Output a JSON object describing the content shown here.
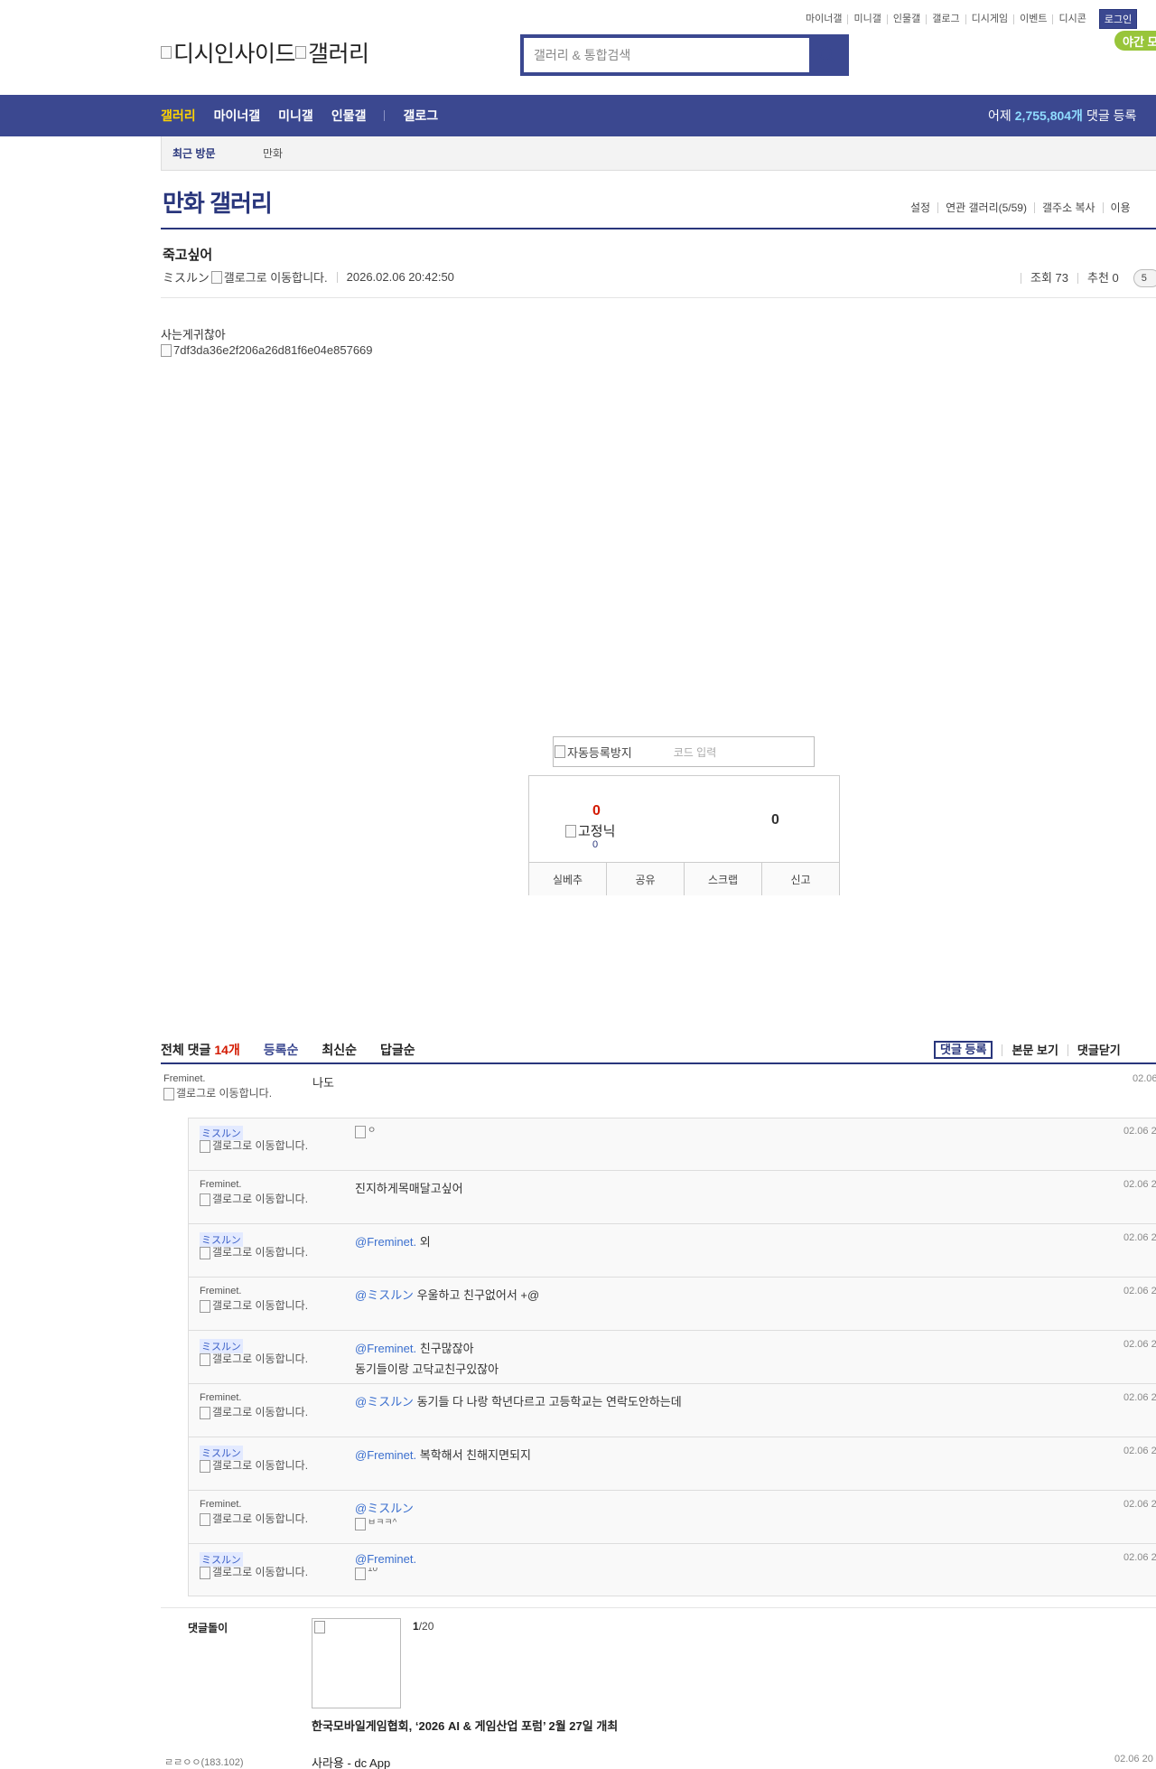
{
  "util_nav": [
    "마이너갤",
    "미니갤",
    "인물갤",
    "갤로그",
    "디시게임",
    "이벤트",
    "디시콘"
  ],
  "login": "로그인",
  "logo": {
    "site": "디시인사이드",
    "section": "갤러리"
  },
  "search": {
    "placeholder": "갤러리 & 통합검색"
  },
  "night_mode": "야간 모",
  "main_nav": {
    "items": [
      "갤러리",
      "마이너갤",
      "미니갤",
      "인물갤"
    ],
    "extra": "갤로그"
  },
  "stats": {
    "prefix": "어제",
    "count": "2,755,804개",
    "suffix": "댓글 등록"
  },
  "recent": {
    "label": "최근 방문",
    "gallery": "만화"
  },
  "gallery": {
    "title": "만화 갤러리",
    "tools": [
      "설정",
      "연관 갤러리(5/59)",
      "갤주소 복사",
      "이용"
    ]
  },
  "post": {
    "title": "죽고싶어",
    "author": "ミスルン",
    "galog_alt": "갤로그로 이동합니다.",
    "date": "2026.02.06 20:42:50",
    "views": "조회 73",
    "recommend": "추천 0",
    "comment_pill": "5",
    "body_text": "사는게귀찮아",
    "image_alt": "7df3da36e2f206a26d81f6e04e857669"
  },
  "captcha": {
    "image_alt": "자동등록방지",
    "placeholder": "코드 입력"
  },
  "reco": {
    "up": "0",
    "fixed_alt": "고정닉",
    "fixed_count": "0",
    "down": "0",
    "buttons": [
      "실베추",
      "공유",
      "스크랩",
      "신고"
    ]
  },
  "comments_header": {
    "label": "전체 댓글",
    "count": "14개",
    "sorts": [
      "등록순",
      "최신순",
      "답글순"
    ],
    "actions": {
      "register": "댓글 등록",
      "view_body": "본문 보기",
      "close": "댓글닫기"
    }
  },
  "galog_alt": "갤로그로 이동합니다.",
  "comments": [
    {
      "nick": "Freminet.",
      "text": "나도",
      "date": "02.06"
    },
    {
      "nick": "ミスルン",
      "mention": "",
      "text": "",
      "image_alt": "ㅇ",
      "date": "02.06 2"
    },
    {
      "nick": "Freminet.",
      "mention": "",
      "text": "진지하게목매달고싶어",
      "date": "02.06 2"
    },
    {
      "nick": "ミスルン",
      "mention": "@Freminet.",
      "text": "외",
      "date": "02.06 2"
    },
    {
      "nick": "Freminet.",
      "mention": "@ミスルン",
      "text": "우울하고 친구없어서 +@",
      "date": "02.06 2"
    },
    {
      "nick": "ミスルン",
      "mention": "@Freminet.",
      "text": "친구많잖아",
      "text2": "동기들이랑 고닥교친구있잖아",
      "date": "02.06 2"
    },
    {
      "nick": "Freminet.",
      "mention": "@ミスルン",
      "text": "동기들 다 나랑 학년다르고 고등학교는 연락도안하는데",
      "date": "02.06 2"
    },
    {
      "nick": "ミスルン",
      "mention": "@Freminet.",
      "text": "복학해서 친해지면되지",
      "date": "02.06 2"
    },
    {
      "nick": "Freminet.",
      "mention": "@ミスルン",
      "text": "",
      "image_alt": "ㅂㅋㅋ^",
      "date": "02.06 2"
    },
    {
      "nick": "ミスルン",
      "mention": "@Freminet.",
      "text": "",
      "image_alt": "10",
      "date": "02.06 2"
    }
  ],
  "dcbot": {
    "title": "댓글돌이",
    "page_current": "1",
    "page_total": "/20",
    "news": "한국모바일게임협회, ‘2026 AI & 게임산업 포럼’ 2월 27일 개최"
  },
  "last_comment": {
    "nick": "ㄹㄹㅇㅇ",
    "ip": "(183.102)",
    "text": "사라용 - dc App",
    "date": "02.06 20"
  }
}
